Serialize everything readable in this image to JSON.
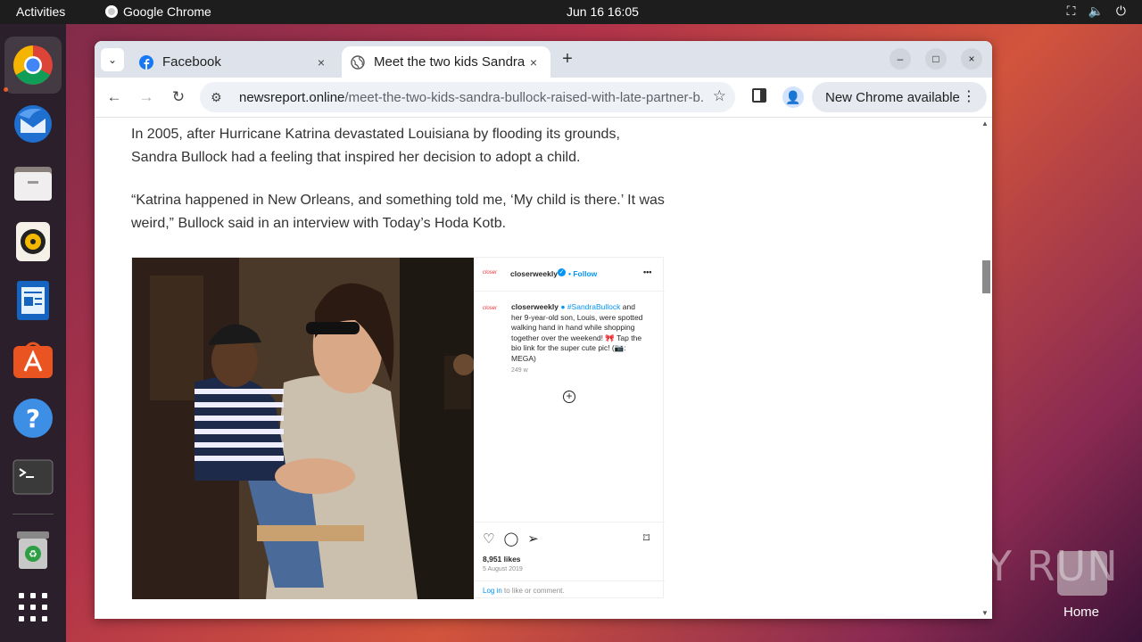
{
  "topbar": {
    "activities": "Activities",
    "app_name": "Google Chrome",
    "clock": "Jun 16  16:05"
  },
  "dock": {
    "items": [
      "chrome-icon",
      "thunderbird-icon",
      "files-icon",
      "rhythmbox-icon",
      "libreoffice-writer-icon",
      "app-center-icon",
      "help-icon",
      "terminal-icon",
      "trash-icon",
      "show-apps-icon"
    ]
  },
  "browser": {
    "tabs": [
      {
        "title": "Facebook",
        "icon": "facebook-icon",
        "close": "×"
      },
      {
        "title": "Meet the two kids Sandra",
        "icon": "globe-icon",
        "close": "×"
      }
    ],
    "new_tab": "+",
    "window_buttons": {
      "minimize": "–",
      "maximize": "□",
      "close": "×"
    },
    "url_domain": "newsreport.online",
    "url_path": "/meet-the-two-kids-sandra-bullock-raised-with-late-partner-b...",
    "update_label": "New Chrome available"
  },
  "article": {
    "para1": "In 2005, after Hurricane Katrina devastated Louisiana by flooding its grounds, Sandra Bullock had a feeling that inspired her decision to adopt a child.",
    "para2": "“Katrina happened in New Orleans, and something told me, ‘My child is there.’ It was weird,” Bullock said in an interview with Today’s Hoda Kotb."
  },
  "instagram": {
    "logo": "closer",
    "account": "closerweekly",
    "follow": "• Follow",
    "more": "•••",
    "caption_user": "closerweekly",
    "caption_tag": "#SandraBullock",
    "caption_text": " and her 9-year-old son, Louis, were spotted walking hand in hand while shopping together over the weekend! 🎀 Tap the bio link for the super cute pic! (📷: MEGA)",
    "age": "249 w",
    "likes": "8,951 likes",
    "date": "5 August 2019",
    "login_link": "Log in",
    "login_text": " to like or comment."
  },
  "desktop": {
    "watermark": "ANY RUN",
    "home_label": "Home"
  }
}
